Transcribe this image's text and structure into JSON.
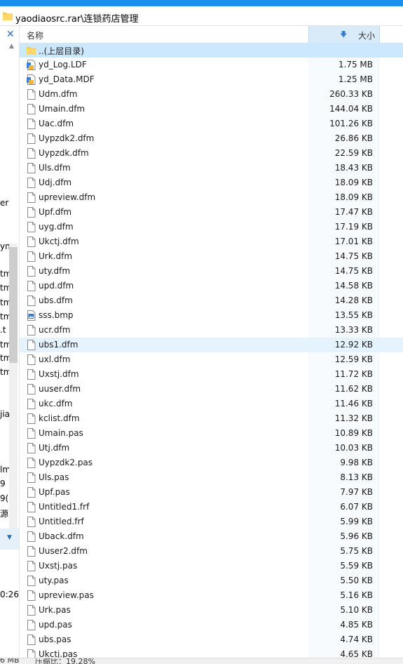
{
  "window": {
    "title": "yaodiaosrc.rar\\连锁药店管理"
  },
  "columns": {
    "name": "名称",
    "size": "大小"
  },
  "left_pane": {
    "fragments": [
      "er",
      "yn",
      "tm",
      "tm",
      "tm",
      "tm",
      ".t",
      "tm",
      "tm",
      "tm",
      "jia",
      "lm",
      "9",
      "9(",
      "源",
      "0:26"
    ]
  },
  "files": [
    {
      "name": "..(上层目录)",
      "size": "",
      "icon": "folder-icon"
    },
    {
      "name": "yd_Log.LDF",
      "size": "1.75 MB",
      "icon": "db-file-icon"
    },
    {
      "name": "yd_Data.MDF",
      "size": "1.25 MB",
      "icon": "db-file-icon"
    },
    {
      "name": "Udm.dfm",
      "size": "260.33 KB",
      "icon": "file-icon"
    },
    {
      "name": "Umain.dfm",
      "size": "144.04 KB",
      "icon": "file-icon"
    },
    {
      "name": "Uac.dfm",
      "size": "101.26 KB",
      "icon": "file-icon"
    },
    {
      "name": "Uypzdk2.dfm",
      "size": "26.86 KB",
      "icon": "file-icon"
    },
    {
      "name": "Uypzdk.dfm",
      "size": "22.59 KB",
      "icon": "file-icon"
    },
    {
      "name": "Uls.dfm",
      "size": "18.43 KB",
      "icon": "file-icon"
    },
    {
      "name": "Udj.dfm",
      "size": "18.09 KB",
      "icon": "file-icon"
    },
    {
      "name": "upreview.dfm",
      "size": "18.09 KB",
      "icon": "file-icon"
    },
    {
      "name": "Upf.dfm",
      "size": "17.47 KB",
      "icon": "file-icon"
    },
    {
      "name": "uyg.dfm",
      "size": "17.19 KB",
      "icon": "file-icon"
    },
    {
      "name": "Ukctj.dfm",
      "size": "17.01 KB",
      "icon": "file-icon"
    },
    {
      "name": "Urk.dfm",
      "size": "14.75 KB",
      "icon": "file-icon"
    },
    {
      "name": "uty.dfm",
      "size": "14.75 KB",
      "icon": "file-icon"
    },
    {
      "name": "upd.dfm",
      "size": "14.58 KB",
      "icon": "file-icon"
    },
    {
      "name": "ubs.dfm",
      "size": "14.28 KB",
      "icon": "file-icon"
    },
    {
      "name": "sss.bmp",
      "size": "13.55 KB",
      "icon": "image-file-icon"
    },
    {
      "name": "ucr.dfm",
      "size": "13.33 KB",
      "icon": "file-icon"
    },
    {
      "name": "ubs1.dfm",
      "size": "12.92 KB",
      "icon": "file-icon"
    },
    {
      "name": "uxl.dfm",
      "size": "12.59 KB",
      "icon": "file-icon"
    },
    {
      "name": "Uxstj.dfm",
      "size": "11.72 KB",
      "icon": "file-icon"
    },
    {
      "name": "uuser.dfm",
      "size": "11.62 KB",
      "icon": "file-icon"
    },
    {
      "name": "ukc.dfm",
      "size": "11.46 KB",
      "icon": "file-icon"
    },
    {
      "name": "kclist.dfm",
      "size": "11.32 KB",
      "icon": "file-icon"
    },
    {
      "name": "Umain.pas",
      "size": "10.89 KB",
      "icon": "file-icon"
    },
    {
      "name": "Utj.dfm",
      "size": "10.03 KB",
      "icon": "file-icon"
    },
    {
      "name": "Uypzdk2.pas",
      "size": "9.98 KB",
      "icon": "file-icon"
    },
    {
      "name": "Uls.pas",
      "size": "8.13 KB",
      "icon": "file-icon"
    },
    {
      "name": "Upf.pas",
      "size": "7.97 KB",
      "icon": "file-icon"
    },
    {
      "name": "Untitled1.frf",
      "size": "6.07 KB",
      "icon": "file-icon"
    },
    {
      "name": "Untitled.frf",
      "size": "5.99 KB",
      "icon": "file-icon"
    },
    {
      "name": "Uback.dfm",
      "size": "5.96 KB",
      "icon": "file-icon"
    },
    {
      "name": "Uuser2.dfm",
      "size": "5.75 KB",
      "icon": "file-icon"
    },
    {
      "name": "Uxstj.pas",
      "size": "5.59 KB",
      "icon": "file-icon"
    },
    {
      "name": "uty.pas",
      "size": "5.50 KB",
      "icon": "file-icon"
    },
    {
      "name": "upreview.pas",
      "size": "5.16 KB",
      "icon": "file-icon"
    },
    {
      "name": "Urk.pas",
      "size": "5.10 KB",
      "icon": "file-icon"
    },
    {
      "name": "upd.pas",
      "size": "4.85 KB",
      "icon": "file-icon"
    },
    {
      "name": "ubs.pas",
      "size": "4.74 KB",
      "icon": "file-icon"
    },
    {
      "name": "Ukctj.pas",
      "size": "4.65 KB",
      "icon": "file-icon"
    }
  ],
  "selected_index": 0,
  "hover_index": 20,
  "status": {
    "size": "6 MB",
    "ratio": "压缩比：19.28%"
  }
}
